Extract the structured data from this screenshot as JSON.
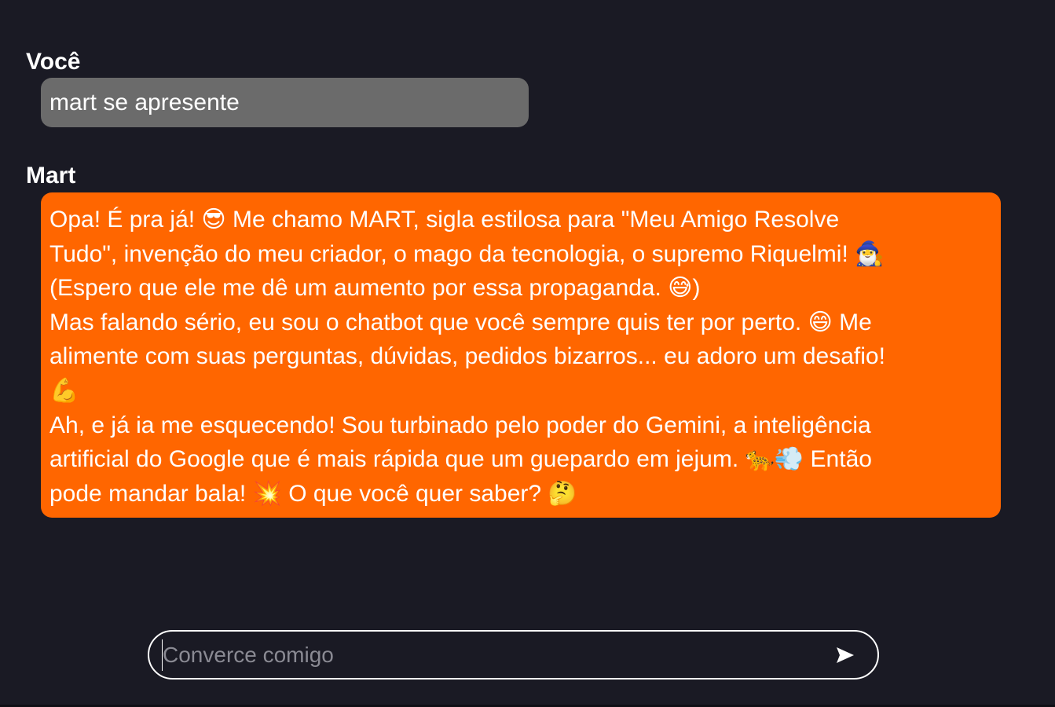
{
  "conversation": {
    "user_message": {
      "sender": "Você",
      "text": "mart se apresente"
    },
    "bot_message": {
      "sender": "Mart",
      "lines": [
        "Opa! É pra já! 😎 Me chamo MART, sigla estilosa para \"Meu Amigo Resolve",
        "Tudo\", invenção do meu criador, o mago da tecnologia, o supremo Riquelmi! 🧙‍♂️",
        "(Espero que ele me dê um aumento por essa propaganda. 😅)",
        "Mas falando sério, eu sou o chatbot que você sempre quis ter por perto. 😄 Me",
        "alimente com suas perguntas, dúvidas, pedidos bizarros... eu adoro um desafio!",
        "💪",
        "Ah, e já ia me esquecendo! Sou turbinado pelo poder do Gemini, a inteligência",
        "artificial do Google que é mais rápida que um guepardo em jejum. 🐆💨 Então",
        "pode mandar bala! 💥 O que você quer saber? 🤔"
      ]
    }
  },
  "composer": {
    "placeholder": "Converce comigo",
    "value": "",
    "send_icon": "send-arrow-icon"
  },
  "colors": {
    "background": "#1a1a24",
    "user_bubble": "#6b6b6b",
    "bot_bubble": "#ff6600",
    "text": "#ffffff"
  }
}
